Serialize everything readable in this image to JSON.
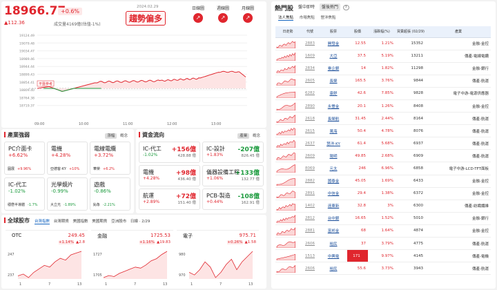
{
  "index": {
    "value": "18966.77",
    "change_pct": "+0.6%",
    "change_pts": "▲112.36",
    "volume": "成交量4169億(估值-1%)",
    "date": "2024.02.29",
    "trend": "趨勢偏多",
    "kbars": [
      {
        "label": "日線圖",
        "icon": "up-arrow-icon"
      },
      {
        "label": "週線圖",
        "icon": "up-arrow-icon"
      },
      {
        "label": "月線圖",
        "icon": "up-arrow-icon"
      }
    ],
    "y_ticks": [
      "19124.49",
      "19079.48",
      "19034.47",
      "18989.46",
      "18944.44",
      "18899.43",
      "18854.41",
      "18809.40",
      "18764.38",
      "18719.37"
    ],
    "x_ticks": [
      "09:00",
      "10:00",
      "11:00",
      "12:00",
      "13:00"
    ],
    "ref_label": "平盤參考"
  },
  "sectors": {
    "title": "產業強弱",
    "tabs": [
      "漲幅",
      "概念"
    ],
    "cards": [
      {
        "name": "PC介面卡",
        "pct": "+6.62%",
        "dir": "up",
        "stock": "圓展",
        "stock_pct": "+9.96%"
      },
      {
        "name": "電機",
        "pct": "+4.28%",
        "dir": "up",
        "stock": "亞德客-KY",
        "stock_pct": "+10%"
      },
      {
        "name": "電線電纜",
        "pct": "+3.72%",
        "dir": "up",
        "stock": "華榮",
        "stock_pct": "+6.2%"
      },
      {
        "name": "IC-代工",
        "pct": "-1.02%",
        "dir": "down",
        "stock": "穩懋半導體",
        "stock_pct": "-1.7%"
      },
      {
        "name": "光學鏡片",
        "pct": "-0.99%",
        "dir": "down",
        "stock": "大立光",
        "stock_pct": "-1.89%"
      },
      {
        "name": "遊戲",
        "pct": "-0.86%",
        "dir": "down",
        "stock": "鈊象",
        "stock_pct": "-2.21%"
      }
    ]
  },
  "funds": {
    "title": "資金流向",
    "tabs": [
      "產業",
      "概念"
    ],
    "cards": [
      {
        "name": "IC-代工",
        "pct": "-1.02%",
        "pdir": "down",
        "amount": "+156億",
        "adir": "up",
        "sub": "428.88 億"
      },
      {
        "name": "IC-設計",
        "pct": "+1.83%",
        "pdir": "up",
        "amount": "-207億",
        "adir": "down",
        "sub": "826.45 億"
      },
      {
        "name": "電機",
        "pct": "+4.28%",
        "pdir": "up",
        "amount": "+98億",
        "adir": "up",
        "sub": "436.40 億"
      },
      {
        "name": "儀器設備工程",
        "pct": "+1.06%",
        "pdir": "up",
        "amount": "+133億",
        "adir": "down",
        "sub": "132.77 億"
      },
      {
        "name": "航運",
        "pct": "+2.89%",
        "pdir": "up",
        "amount": "+72億",
        "adir": "up",
        "sub": "151.40 億"
      },
      {
        "name": "PCB-製造",
        "pct": "+0.44%",
        "pdir": "up",
        "amount": "-108億",
        "adir": "down",
        "sub": "162.91 億"
      }
    ]
  },
  "global": {
    "title": "全球股市",
    "tabs": [
      "台灣指數",
      "台灣期貨",
      "美國指數",
      "美國期貨",
      "亞洲股市",
      "日線 · 2/29"
    ],
    "cards": [
      {
        "name": "OTC",
        "value": "249.45",
        "chg_pct": "+1.14%",
        "chg": "▲2.8",
        "y_top": "247",
        "y_bot": "237",
        "x_ticks": [
          "1",
          "7",
          "13"
        ],
        "line": [
          235,
          236,
          234,
          237,
          239,
          241,
          240,
          243,
          245,
          244,
          247,
          248,
          249
        ]
      },
      {
        "name": "金融",
        "value": "1725.53",
        "chg_pct": "+1.16%",
        "chg": "▲19.83",
        "y_top": "1727",
        "y_bot": "1705",
        "x_ticks": [
          "1",
          "7",
          "13"
        ],
        "line": [
          1700,
          1702,
          1701,
          1704,
          1706,
          1708,
          1710,
          1709,
          1712,
          1716,
          1718,
          1722,
          1725
        ]
      },
      {
        "name": "電子",
        "value": "975.71",
        "chg_pct": "+0.26%",
        "chg": "▲1.58",
        "y_top": "980",
        "y_bot": "970",
        "x_ticks": [
          "1",
          "7",
          "13"
        ],
        "line": [
          968,
          967,
          969,
          972,
          970,
          966,
          968,
          971,
          973,
          969,
          972,
          974,
          976
        ]
      }
    ]
  },
  "hot": {
    "title": "熱門股",
    "tabs": [
      "盤中即時",
      "盤後熱門"
    ],
    "sub_tabs": [
      "法人焦點",
      "市場焦點",
      "營沖焦點"
    ],
    "columns": [
      "日走勢",
      "代號",
      "股票",
      "股價",
      "漲跌幅(%)",
      "買賣超張 (02/29)",
      "產業"
    ],
    "rows": [
      {
        "code": "2883",
        "name": "開發金",
        "price": "12.55",
        "pct": "1.21%",
        "vol": "15352",
        "ind": "金融-金控"
      },
      {
        "code": "1609",
        "name": "大亞",
        "price": "37.5",
        "pct": "5.19%",
        "vol": "13211",
        "ind": "傳產-電線電纜"
      },
      {
        "code": "2834",
        "name": "臺企銀",
        "price": "14",
        "pct": "1.82%",
        "vol": "11298",
        "ind": "金融-銀行"
      },
      {
        "code": "2605",
        "name": "長榮",
        "price": "165.5",
        "pct": "3.76%",
        "vol": "9844",
        "ind": "傳產-航運"
      },
      {
        "code": "6282",
        "name": "康舒",
        "price": "42.6",
        "pct": "7.85%",
        "vol": "9828",
        "ind": "電子中游-電源供應器"
      },
      {
        "code": "2890",
        "name": "永豐金",
        "price": "20.1",
        "pct": "1.26%",
        "vol": "8408",
        "ind": "金融-金控"
      },
      {
        "code": "2618",
        "name": "長榮航",
        "price": "31.45",
        "pct": "2.44%",
        "vol": "8164",
        "ind": "傳產-航運"
      },
      {
        "code": "2615",
        "name": "萬海",
        "price": "50.4",
        "pct": "4.78%",
        "vol": "8076",
        "ind": "傳產-航運"
      },
      {
        "code": "2637",
        "name": "慧洋-KY",
        "price": "61.4",
        "pct": "5.68%",
        "vol": "6937",
        "ind": "傳產-航運"
      },
      {
        "code": "2609",
        "name": "陽明",
        "price": "49.85",
        "pct": "2.68%",
        "vol": "6909",
        "ind": "傳產-航運"
      },
      {
        "code": "8069",
        "name": "元太",
        "price": "246",
        "pct": "6.96%",
        "vol": "6858",
        "ind": "電子中游-LCD-TFT面板"
      },
      {
        "code": "2882",
        "name": "國泰金",
        "price": "45.05",
        "pct": "1.69%",
        "vol": "6433",
        "ind": "金融-金控"
      },
      {
        "code": "2891",
        "name": "中信金",
        "price": "29.4",
        "pct": "1.38%",
        "vol": "6372",
        "ind": "金融-金控"
      },
      {
        "code": "1402",
        "name": "遠東新",
        "price": "32.8",
        "pct": "3%",
        "vol": "6300",
        "ind": "傳產-紡織纖維"
      },
      {
        "code": "2812",
        "name": "台中銀",
        "price": "16.65",
        "pct": "1.52%",
        "vol": "5010",
        "ind": "金融-銀行"
      },
      {
        "code": "2881",
        "name": "富邦金",
        "price": "68",
        "pct": "1.64%",
        "vol": "4874",
        "ind": "金融-金控"
      },
      {
        "code": "2606",
        "name": "裕民",
        "price": "37",
        "pct": "3.79%",
        "vol": "4775",
        "ind": "傳產-航運"
      },
      {
        "code": "1513",
        "name": "中興電",
        "price": "171",
        "pct": "9.97%",
        "vol": "4145",
        "ind": "傳產-電機",
        "limit": true
      },
      {
        "code": "2606",
        "name": "裕民",
        "price": "55.6",
        "pct": "3.73%",
        "vol": "3943",
        "ind": "傳產-航運"
      }
    ]
  },
  "colors": {
    "up": "#e0262e",
    "down": "#1a9a3c",
    "accent": "#1565c0"
  }
}
